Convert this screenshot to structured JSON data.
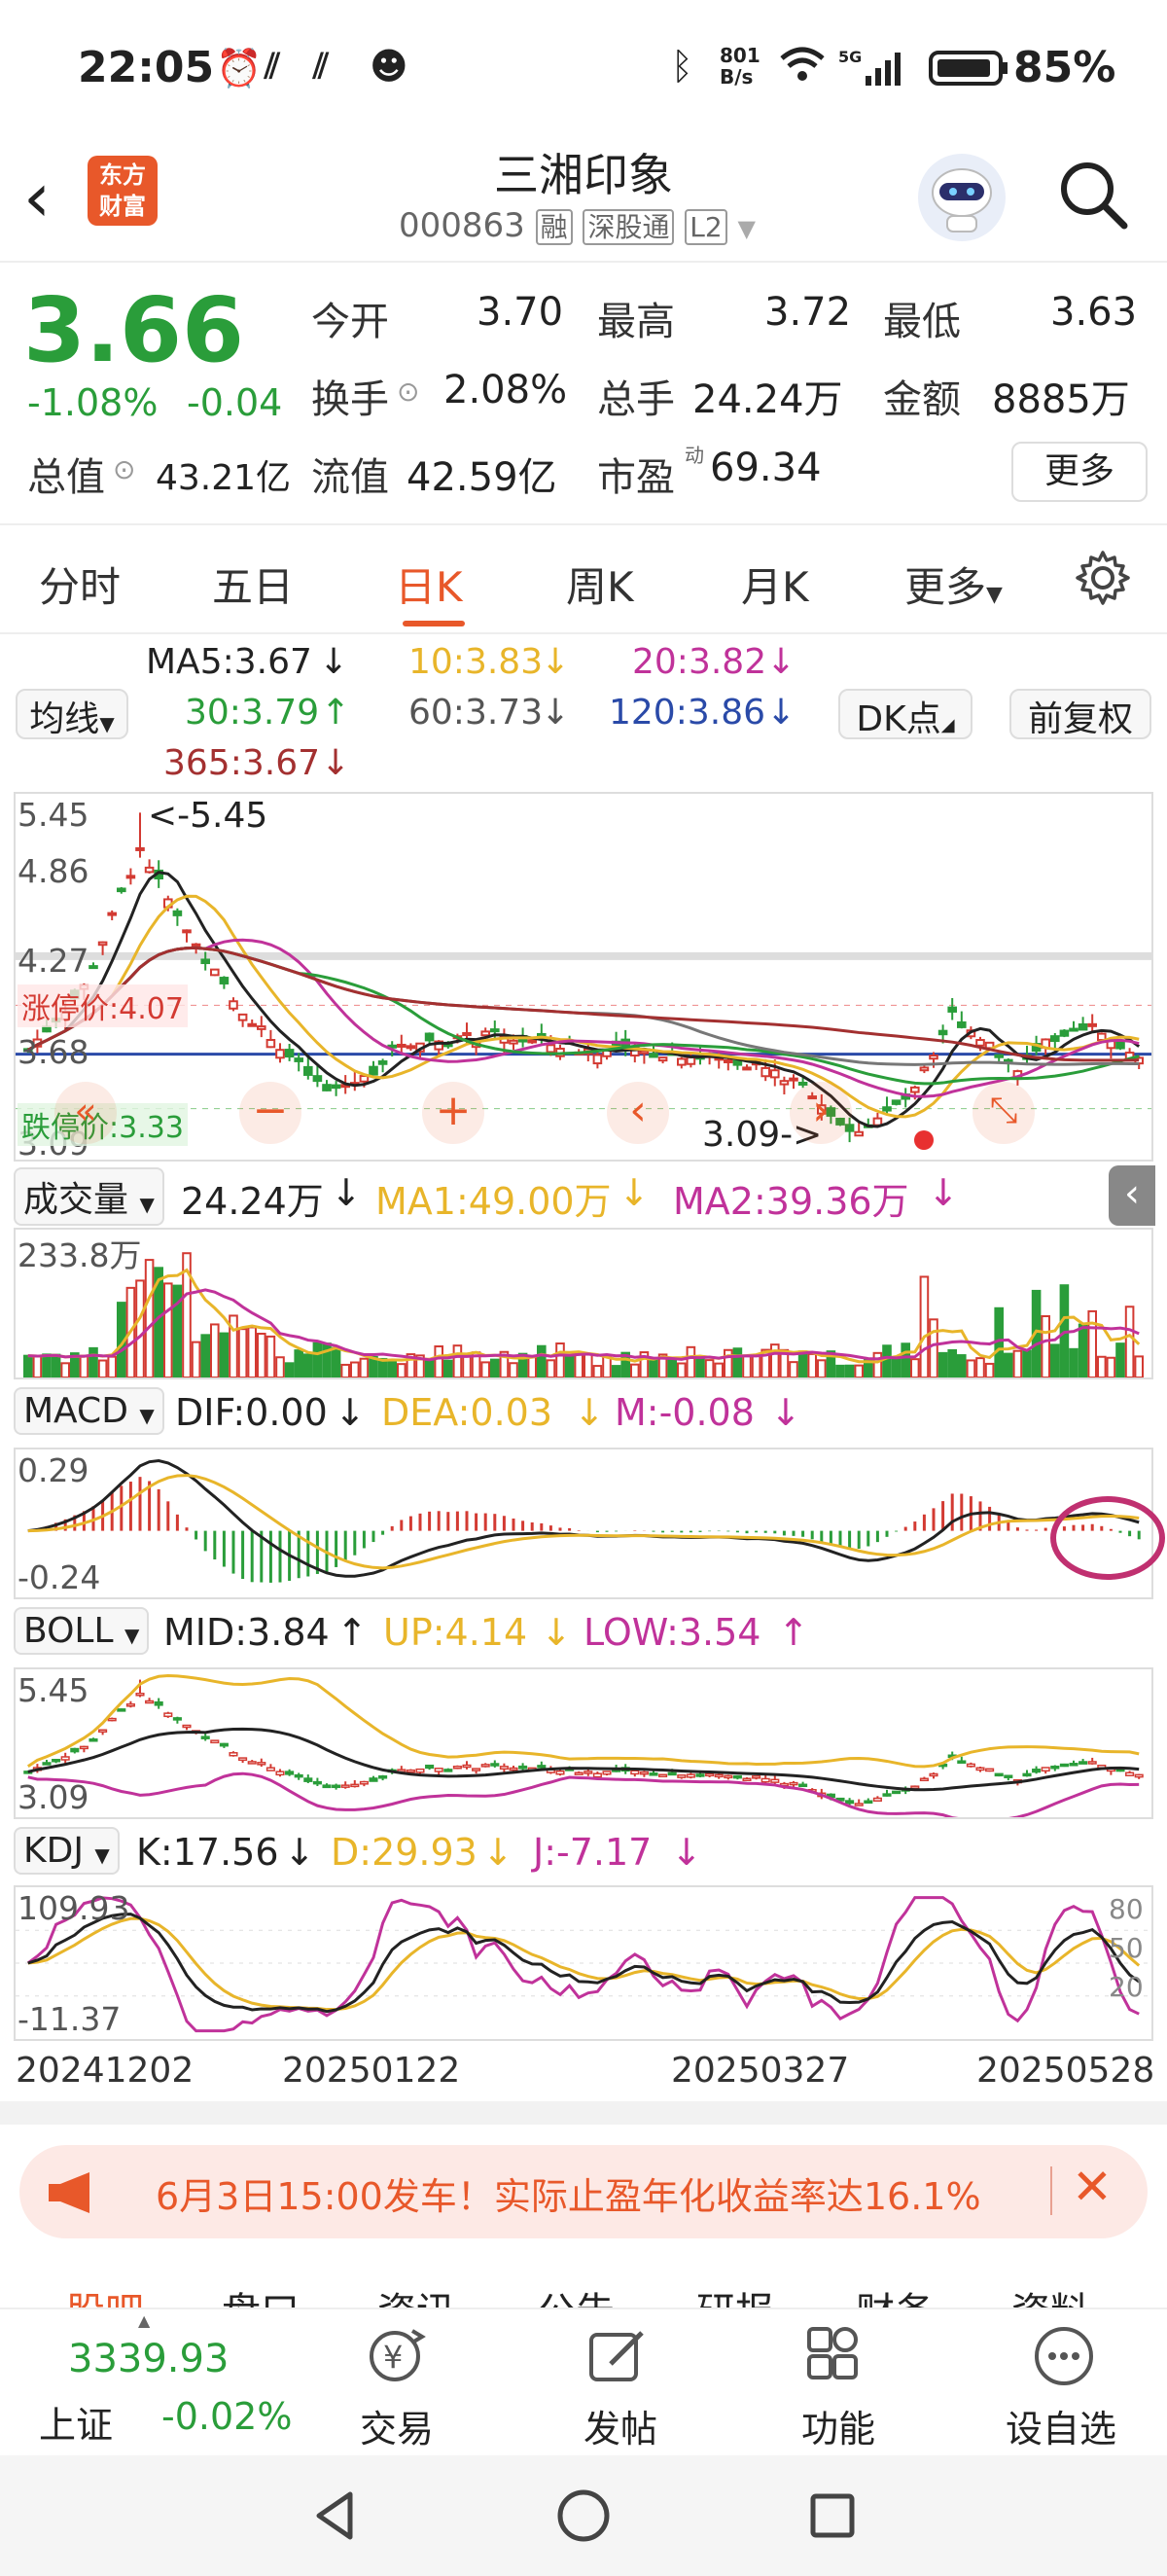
{
  "status_bar": {
    "time": "22:05",
    "net_speed_top": "801",
    "net_speed_bottom": "B/s",
    "battery": "85%"
  },
  "header": {
    "title": "三湘印象",
    "code": "000863",
    "tags": [
      "融",
      "深股通",
      "L2"
    ],
    "logo_top": "东方",
    "logo_bottom": "财富"
  },
  "quote": {
    "price": "3.66",
    "change_pct": "-1.08%",
    "change": "-0.04",
    "open_label": "今开",
    "open": "3.70",
    "high_label": "最高",
    "high": "3.72",
    "low_label": "最低",
    "low": "3.63",
    "turnover_label": "换手",
    "turnover": "2.08%",
    "volume_label": "总手",
    "volume": "24.24万",
    "amount_label": "金额",
    "amount": "8885万",
    "mcap_label": "总值",
    "mcap": "43.21亿",
    "float_label": "流值",
    "float": "42.59亿",
    "pe_label": "市盈",
    "pe_sup": "动",
    "pe": "69.34",
    "more": "更多"
  },
  "tabs": [
    "分时",
    "五日",
    "日K",
    "周K",
    "月K",
    "更多"
  ],
  "active_tab": "日K",
  "ma": {
    "ma5": "MA5:3.67",
    "ma10": "10:3.83",
    "ma20": "20:3.82",
    "ma30": "30:3.79",
    "ma60": "60:3.73",
    "ma120": "120:3.86",
    "ma365": "365:3.67",
    "selector": "均线",
    "dk": "DK点",
    "adjust": "前复权"
  },
  "kline": {
    "axis_top": "5.45",
    "axis_2": "4.86",
    "axis_3": "4.27",
    "axis_4": "3.68",
    "axis_bottom": "3.09",
    "limit_up": "涨停价:4.07",
    "limit_down": "跌停价:3.33",
    "max_mark": "<-5.45",
    "min_mark": "3.09->"
  },
  "volume": {
    "selector": "成交量",
    "value": "24.24万",
    "ma1": "MA1:49.00万",
    "ma2": "MA2:39.36万",
    "axis_top": "233.8万"
  },
  "macd": {
    "selector": "MACD",
    "dif": "DIF:0.00",
    "dea": "DEA:0.03",
    "m": "M:-0.08",
    "axis_top": "0.29",
    "axis_bottom": "-0.24"
  },
  "boll": {
    "selector": "BOLL",
    "mid": "MID:3.84",
    "up": "UP:4.14",
    "low": "LOW:3.54",
    "axis_top": "5.45",
    "axis_bottom": "3.09"
  },
  "kdj": {
    "selector": "KDJ",
    "k": "K:17.56",
    "d": "D:29.93",
    "j": "J:-7.17",
    "axis_top": "109.93",
    "axis_bottom": "-11.37",
    "r80": "80",
    "r50": "50",
    "r20": "20"
  },
  "dates": [
    "20241202",
    "20250122",
    "20250327",
    "20250528"
  ],
  "banner": {
    "text": "6月3日15:00发车！实际止盈年化收益率达16.1%"
  },
  "bottom_tabs_peek": [
    "股吧",
    "盘口",
    "资讯",
    "公告",
    "研报",
    "财务",
    "资料"
  ],
  "bottom": {
    "index_value": "3339.93",
    "index_name": "上证",
    "index_change": "-0.02%",
    "trade": "交易",
    "post": "发帖",
    "func": "功能",
    "watch": "设自选"
  }
}
